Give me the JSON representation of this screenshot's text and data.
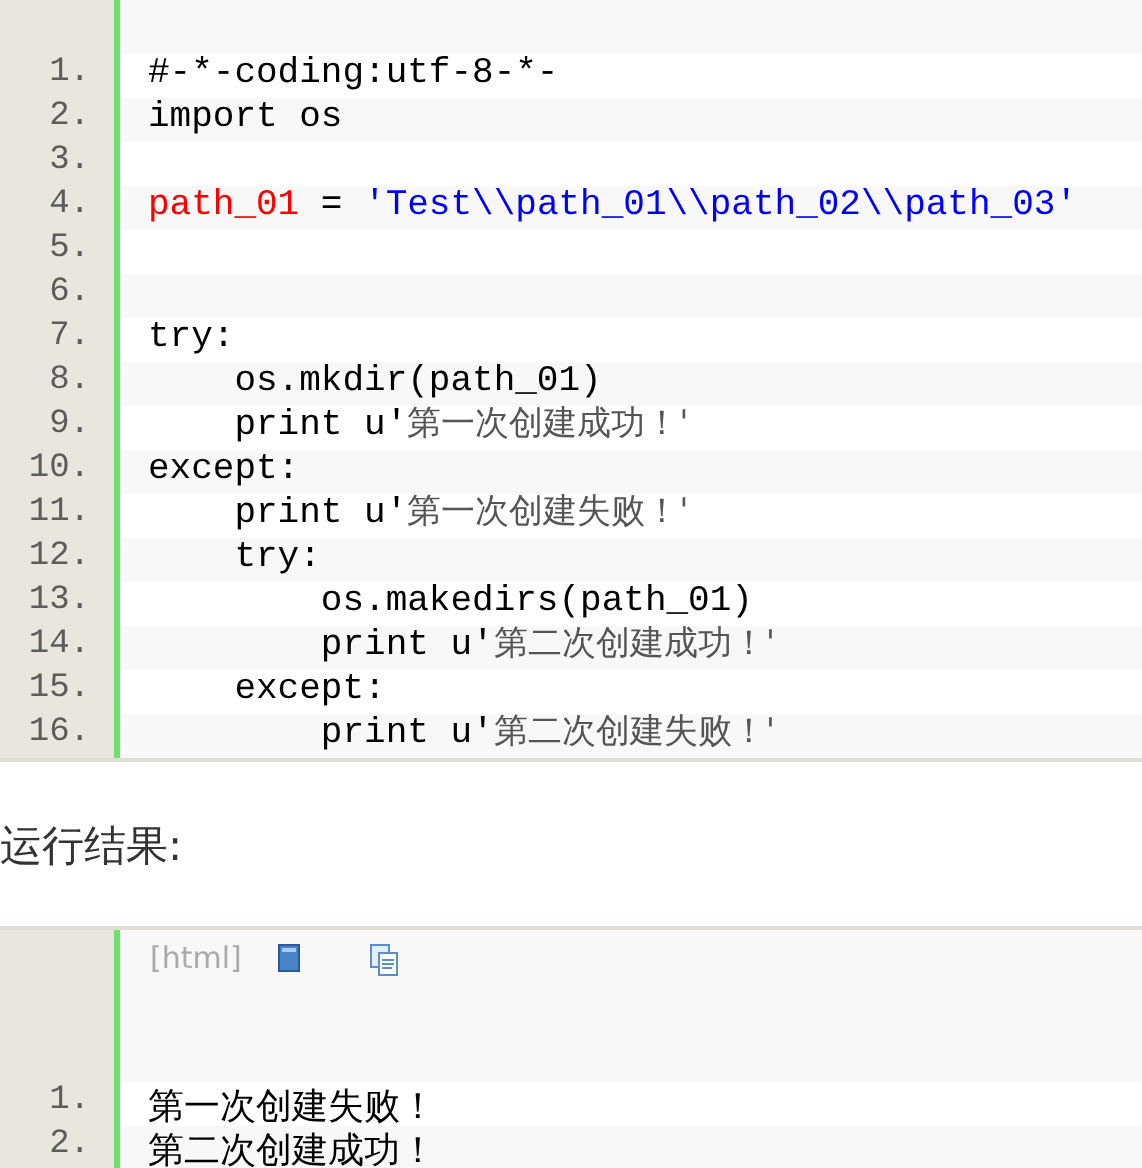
{
  "code_block": {
    "lines": [
      {
        "number": "1.",
        "segments": [
          {
            "kind": "plain",
            "text": "#-*-coding:utf-8-*-"
          }
        ]
      },
      {
        "number": "2.",
        "segments": [
          {
            "kind": "plain",
            "text": "import os"
          }
        ]
      },
      {
        "number": "3."
      },
      {
        "number": "4.",
        "segments": [
          {
            "kind": "variable",
            "text": "path_01"
          },
          {
            "kind": "plain",
            "text": " = "
          },
          {
            "kind": "string",
            "text": "'Test\\\\path_01\\\\path_02\\\\path_03'"
          }
        ]
      },
      {
        "number": "5."
      },
      {
        "number": "6."
      },
      {
        "number": "7.",
        "segments": [
          {
            "kind": "plain",
            "text": "try:"
          }
        ]
      },
      {
        "number": "8.",
        "segments": [
          {
            "kind": "plain",
            "text": "    os.mkdir(path_01)"
          }
        ]
      },
      {
        "number": "9.",
        "segments": [
          {
            "kind": "plain",
            "text": "    print u'"
          },
          {
            "kind": "cjk",
            "text": "第一次创建成功！'"
          }
        ]
      },
      {
        "number": "10.",
        "segments": [
          {
            "kind": "plain",
            "text": "except:"
          }
        ]
      },
      {
        "number": "11.",
        "segments": [
          {
            "kind": "plain",
            "text": "    print u'"
          },
          {
            "kind": "cjk",
            "text": "第一次创建失败！'"
          }
        ]
      },
      {
        "number": "12.",
        "segments": [
          {
            "kind": "plain",
            "text": "    try:"
          }
        ]
      },
      {
        "number": "13.",
        "segments": [
          {
            "kind": "plain",
            "text": "        os.makedirs(path_01)"
          }
        ]
      },
      {
        "number": "14.",
        "segments": [
          {
            "kind": "plain",
            "text": "        print u'"
          },
          {
            "kind": "cjk",
            "text": "第二次创建成功！'"
          }
        ]
      },
      {
        "number": "15.",
        "segments": [
          {
            "kind": "plain",
            "text": "    except:"
          }
        ]
      },
      {
        "number": "16.",
        "segments": [
          {
            "kind": "plain",
            "text": "        print u'"
          },
          {
            "kind": "cjk",
            "text": "第二次创建失败！'"
          }
        ]
      }
    ]
  },
  "result_heading": "运行结果:",
  "output_block": {
    "language": "[html]",
    "lines": [
      {
        "number": "1.",
        "text": "第一次创建失败！"
      },
      {
        "number": "2.",
        "text": "第二次创建成功！"
      }
    ]
  }
}
